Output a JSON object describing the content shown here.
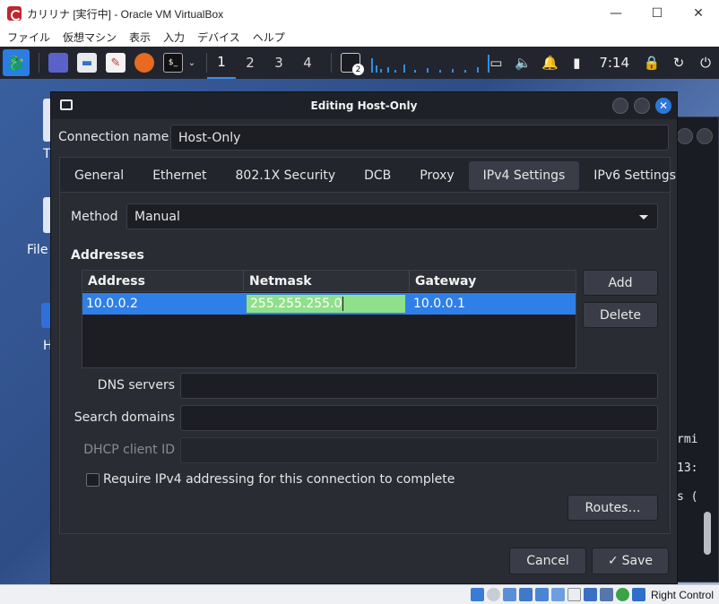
{
  "window": {
    "title": "カリリナ [実行中] - Oracle VM VirtualBox",
    "min_icon": "—",
    "max_icon": "☐",
    "close_icon": "✕"
  },
  "menubar": {
    "items": [
      "ファイル",
      "仮想マシン",
      "表示",
      "入力",
      "デバイス",
      "ヘルプ"
    ]
  },
  "panel": {
    "workspaces": [
      "1",
      "2",
      "3",
      "4"
    ],
    "active_workspace": "1",
    "notification_badge": "2",
    "time": "7:14",
    "terminal_glyph": "$_"
  },
  "desktop": {
    "labels": [
      "T",
      "File",
      "H"
    ]
  },
  "background_terminal": {
    "lines": [
      "rmi",
      "13:",
      "s ("
    ]
  },
  "dialog": {
    "title": "Editing Host-Only",
    "connection_name_label": "Connection name",
    "connection_name_value": "Host-Only",
    "tabs": [
      "General",
      "Ethernet",
      "802.1X Security",
      "DCB",
      "Proxy",
      "IPv4 Settings",
      "IPv6 Settings"
    ],
    "active_tab": "IPv4 Settings",
    "method_label": "Method",
    "method_value": "Manual",
    "addresses_title": "Addresses",
    "table": {
      "headers": [
        "Address",
        "Netmask",
        "Gateway"
      ],
      "rows": [
        {
          "address": "10.0.0.2",
          "netmask": "255.255.255.0",
          "gateway": "10.0.0.1"
        }
      ]
    },
    "add_button": "Add",
    "delete_button": "Delete",
    "dns_label": "DNS servers",
    "dns_value": "",
    "search_label": "Search domains",
    "search_value": "",
    "dhcp_label": "DHCP client ID",
    "dhcp_value": "",
    "require_ipv4_label": "Require IPv4 addressing for this connection to complete",
    "require_ipv4_checked": false,
    "routes_button": "Routes…",
    "cancel_button": "Cancel",
    "save_button": "Save",
    "save_icon": "✓"
  },
  "statusbar": {
    "host_key": "Right Control"
  },
  "colors": {
    "accent": "#2f7fe8",
    "edit_highlight": "#8fe08a",
    "dialog_bg": "#2a2c34",
    "panel_bg": "#23252e"
  }
}
